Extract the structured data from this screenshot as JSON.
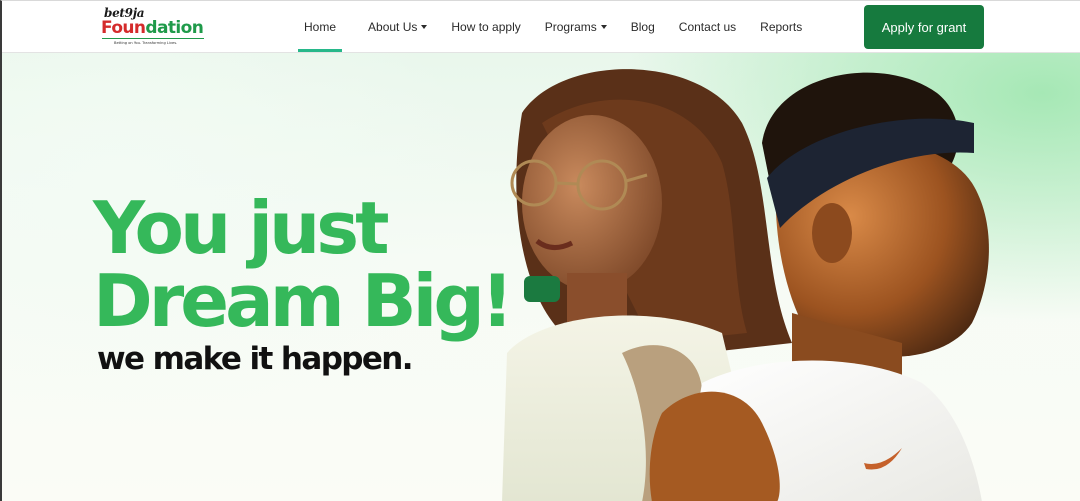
{
  "logo": {
    "brand": "bet9ja",
    "name_part1": "Foun",
    "name_part2": "dation",
    "tagline": "Betting on You. Transforming Lives."
  },
  "nav": {
    "items": [
      {
        "label": "Home",
        "active": true,
        "dropdown": false
      },
      {
        "label": "About Us",
        "active": false,
        "dropdown": true
      },
      {
        "label": "How to apply",
        "active": false,
        "dropdown": false
      },
      {
        "label": "Programs",
        "active": false,
        "dropdown": true
      },
      {
        "label": "Blog",
        "active": false,
        "dropdown": false
      },
      {
        "label": "Contact us",
        "active": false,
        "dropdown": false
      },
      {
        "label": "Reports",
        "active": false,
        "dropdown": false
      }
    ],
    "cta_label": "Apply for grant"
  },
  "hero": {
    "headline_line1": "You just",
    "headline_line2": "Dream Big!",
    "subline": "we make it happen."
  },
  "colors": {
    "brand_green": "#167a3e",
    "headline_green": "#35b85a",
    "active_underline": "#27b88a",
    "logo_red": "#d42b2b"
  }
}
